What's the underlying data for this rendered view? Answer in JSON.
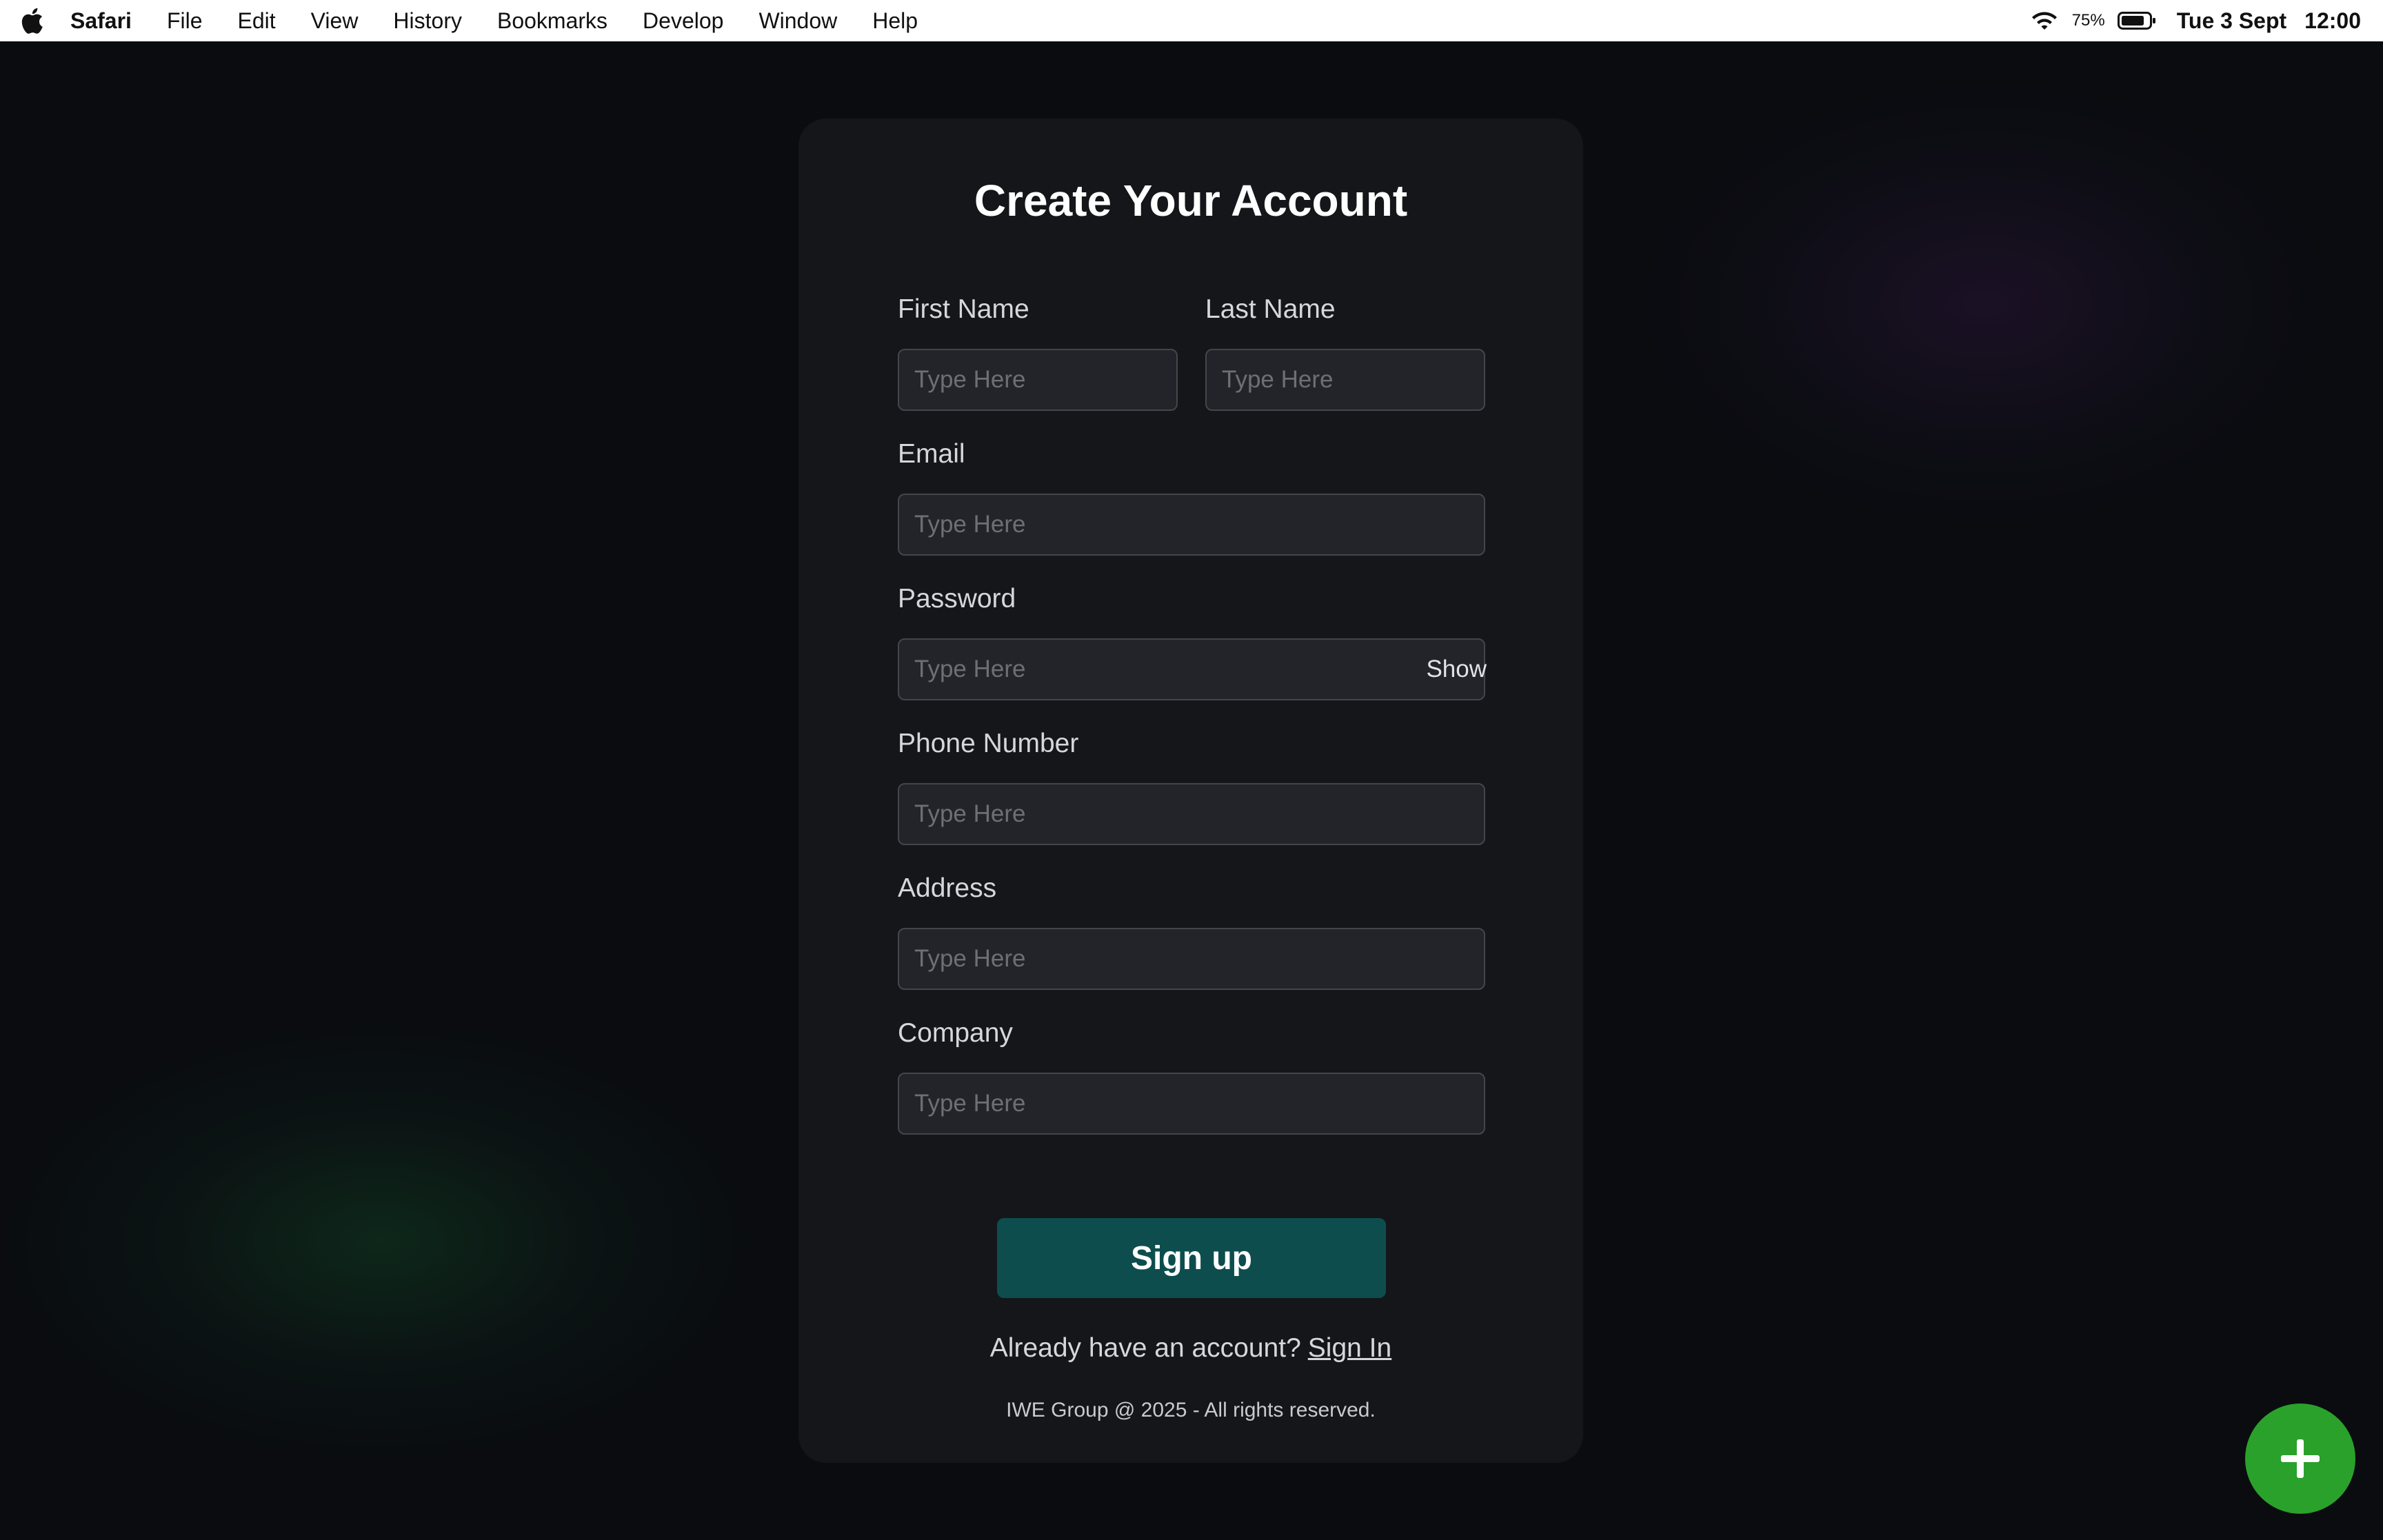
{
  "menubar": {
    "app_name": "Safari",
    "items": [
      "File",
      "Edit",
      "View",
      "History",
      "Bookmarks",
      "Develop",
      "Window",
      "Help"
    ],
    "battery_percent": "75%",
    "date": "Tue 3 Sept",
    "time": "12:00",
    "icons": [
      "apple-logo-icon",
      "wifi-icon",
      "battery-icon"
    ]
  },
  "form": {
    "title": "Create Your Account",
    "fields": {
      "first_name": {
        "label": "First Name",
        "placeholder": "Type Here",
        "value": ""
      },
      "last_name": {
        "label": "Last Name",
        "placeholder": "Type Here",
        "value": ""
      },
      "email": {
        "label": "Email",
        "placeholder": "Type Here",
        "value": ""
      },
      "password": {
        "label": "Password",
        "placeholder": "Type Here",
        "value": "",
        "toggle_label": "Show"
      },
      "phone": {
        "label": "Phone Number",
        "placeholder": "Type Here",
        "value": ""
      },
      "address": {
        "label": "Address",
        "placeholder": "Type Here",
        "value": ""
      },
      "company": {
        "label": "Company",
        "placeholder": "Type Here",
        "value": ""
      }
    },
    "submit_label": "Sign up",
    "signin_prompt": "Already have an account?",
    "signin_link": "Sign In",
    "footer": "IWE Group @ 2025 - All rights reserved."
  },
  "fab": {
    "icon": "plus-icon"
  },
  "colors": {
    "background": "#0a0c10",
    "card": "#15161a",
    "input_bg": "#232429",
    "submit_bg": "#0e4d4d",
    "fab_bg": "#2aa12a"
  }
}
